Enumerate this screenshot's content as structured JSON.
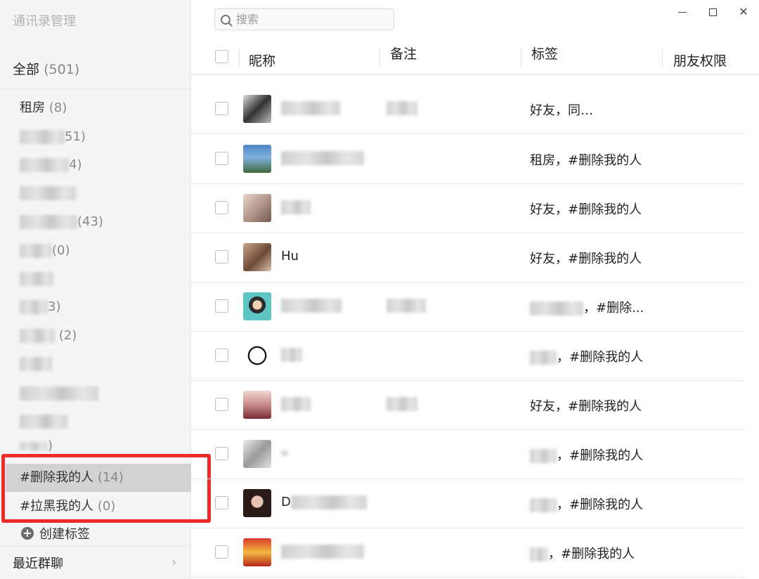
{
  "sidebar": {
    "app_title": "通讯录管理",
    "all_label": "全部",
    "all_count": "(501)",
    "tags": [
      {
        "label": "租房",
        "count": "(8)"
      },
      {
        "label": "",
        "count": "51)"
      },
      {
        "label": "",
        "count": "4)"
      },
      {
        "label": "",
        "count": ""
      },
      {
        "label": "",
        "count": "(43)"
      },
      {
        "label": "",
        "count": "(0)"
      },
      {
        "label": "",
        "count": ""
      },
      {
        "label": "",
        "count": "3)"
      },
      {
        "label": "",
        "count": "(2)"
      },
      {
        "label": "",
        "count": ""
      },
      {
        "label": "",
        "count": ""
      },
      {
        "label": "",
        "count": ""
      },
      {
        "label": "",
        "count": ")"
      }
    ],
    "highlight_tags": [
      {
        "label": "#删除我的人",
        "count": "(14)"
      },
      {
        "label": "#拉黑我的人",
        "count": "(0)"
      }
    ],
    "create_tag_label": "创建标签",
    "recent_groups_label": "最近群聊"
  },
  "main": {
    "search_placeholder": "搜索",
    "columns": {
      "nickname": "昵称",
      "remark": "备注",
      "tags": "标签",
      "permissions": "朋友权限"
    },
    "rows": [
      {
        "nickname": "",
        "tags": "好友，同…"
      },
      {
        "nickname": "",
        "tags": "租房，#删除我的人"
      },
      {
        "nickname": "",
        "tags": "好友，#删除我的人"
      },
      {
        "nickname": "Hu",
        "tags": "好友，#删除我的人"
      },
      {
        "nickname": "",
        "tags": "，#删除..."
      },
      {
        "nickname": "",
        "tags": "，#删除我的人"
      },
      {
        "nickname": "",
        "tags": "好友，#删除我的人"
      },
      {
        "nickname": "",
        "tags": "，#删除我的人"
      },
      {
        "nickname": "D",
        "tags": "，#删除我的人"
      },
      {
        "nickname": "",
        "tags": "，#删除我的人"
      }
    ]
  },
  "window_controls": {
    "close_symbol": "✕"
  },
  "colors": {
    "highlight_box": "#ee2b2b",
    "active_tag_bg": "#d2d2d2",
    "sidebar_bg": "#f5f5f5"
  }
}
